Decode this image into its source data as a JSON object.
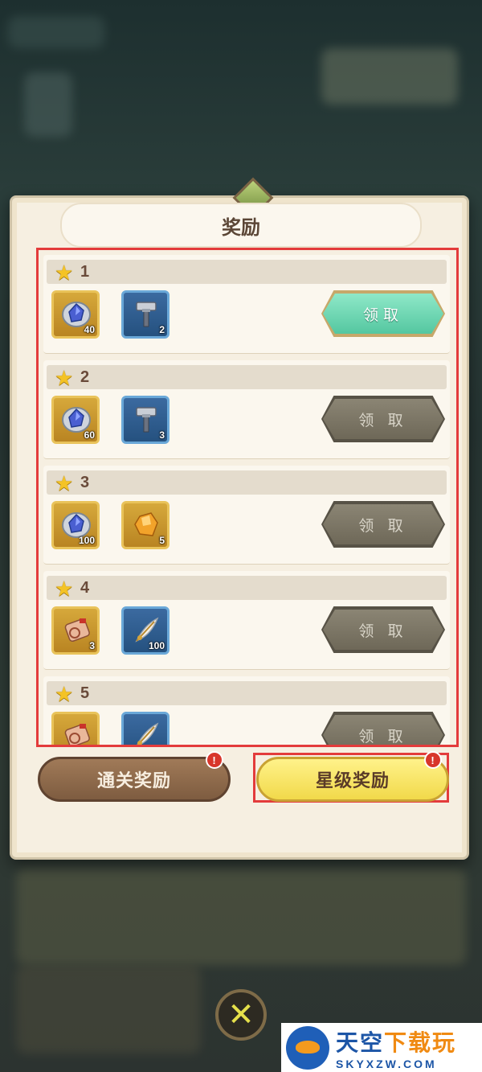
{
  "dialog": {
    "title": "奖励",
    "rows": [
      {
        "stars": "1",
        "items": [
          {
            "icon": "silver-gem-icon",
            "frame": "gold",
            "qty": "40"
          },
          {
            "icon": "hammer-icon",
            "frame": "blue",
            "qty": "2"
          }
        ],
        "claim_label": "领取",
        "claim_state": "active"
      },
      {
        "stars": "2",
        "items": [
          {
            "icon": "silver-gem-icon",
            "frame": "gold",
            "qty": "60"
          },
          {
            "icon": "hammer-icon",
            "frame": "blue",
            "qty": "3"
          }
        ],
        "claim_label": "领 取",
        "claim_state": "disabled"
      },
      {
        "stars": "3",
        "items": [
          {
            "icon": "silver-gem-icon",
            "frame": "gold",
            "qty": "100"
          },
          {
            "icon": "gold-ore-icon",
            "frame": "gold",
            "qty": "5"
          }
        ],
        "claim_label": "领 取",
        "claim_state": "disabled"
      },
      {
        "stars": "4",
        "items": [
          {
            "icon": "scroll-icon",
            "frame": "gold",
            "qty": "3"
          },
          {
            "icon": "feather-icon",
            "frame": "blue",
            "qty": "100"
          }
        ],
        "claim_label": "领 取",
        "claim_state": "disabled"
      },
      {
        "stars": "5",
        "items": [
          {
            "icon": "scroll-icon",
            "frame": "gold",
            "qty": ""
          },
          {
            "icon": "feather-icon",
            "frame": "blue",
            "qty": ""
          }
        ],
        "claim_label": "领 取",
        "claim_state": "disabled"
      }
    ],
    "tabs": {
      "clear_rewards": "通关奖励",
      "star_rewards": "星级奖励",
      "badge": "!"
    }
  },
  "close_symbol": "✕",
  "watermark": {
    "main_left": "天空",
    "main_right": "下载玩",
    "sub": "SKYXZW.COM"
  },
  "colors": {
    "highlight_frame": "#e33b3b",
    "active_claim": "#54c7a0",
    "active_tab": "#f1d94a"
  }
}
